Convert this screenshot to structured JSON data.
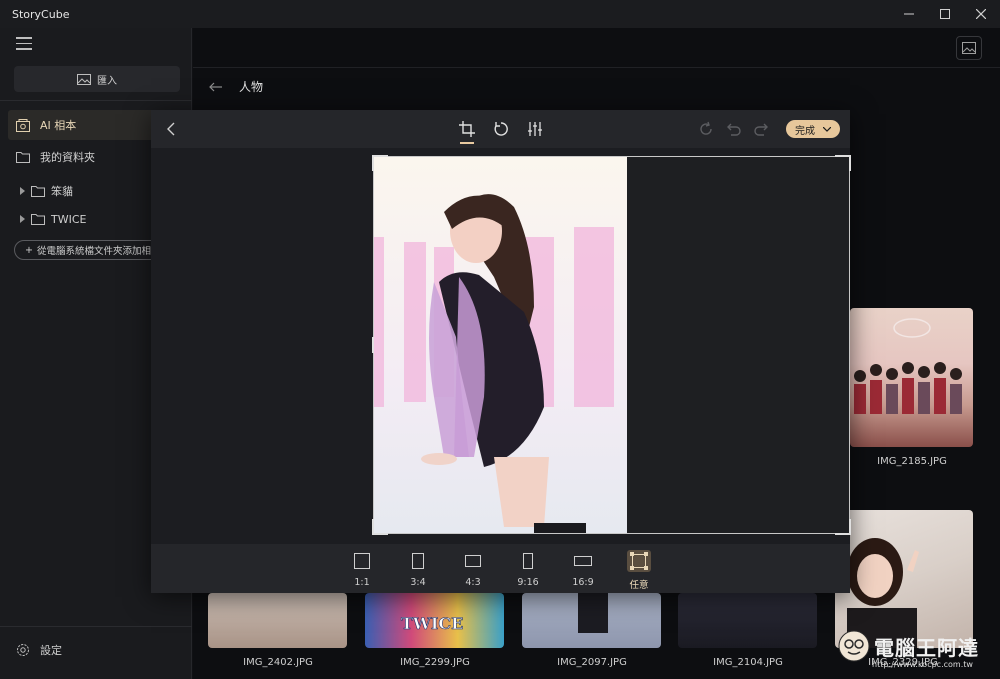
{
  "app": {
    "title": "StoryCube"
  },
  "sidebar": {
    "import_label": "匯入",
    "items": [
      {
        "label": "AI 相本",
        "active": true
      },
      {
        "label": "我的資料夾",
        "active": false
      }
    ],
    "folders": [
      {
        "label": "笨貓"
      },
      {
        "label": "TWICE"
      }
    ],
    "add_folder_label": "從電腦系統檔文件夾添加相",
    "settings_label": "設定"
  },
  "main": {
    "breadcrumb_title": "人物",
    "gallery": [
      {
        "label": "IMG_2185.JPG"
      },
      {
        "label": "IMG_2402.JPG"
      },
      {
        "label": "IMG_2299.JPG"
      },
      {
        "label": "IMG_2097.JPG"
      },
      {
        "label": "IMG_2104.JPG"
      },
      {
        "label": "IMG_2329.JPG"
      }
    ]
  },
  "editor": {
    "done_label": "完成",
    "ratios": [
      {
        "label": "1:1"
      },
      {
        "label": "3:4"
      },
      {
        "label": "4:3"
      },
      {
        "label": "9:16"
      },
      {
        "label": "16:9"
      },
      {
        "label": "任意",
        "selected": true
      }
    ]
  },
  "watermark": {
    "text": "電腦王阿達",
    "url": "http://www.kocpc.com.tw"
  },
  "colors": {
    "accent": "#e7c79b",
    "background": "#0d0e11",
    "panel": "#1c1d21"
  }
}
